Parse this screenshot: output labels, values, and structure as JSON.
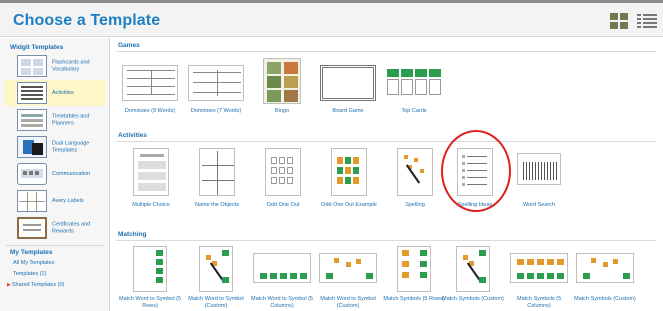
{
  "header": {
    "title": "Choose a Template"
  },
  "sidebar": {
    "widgit_heading": "Widgit Templates",
    "items": [
      {
        "label": "Flashcards and Vocabulary",
        "icon": "flashcards-icon",
        "active": false
      },
      {
        "label": "Activities",
        "icon": "activities-icon",
        "active": true
      },
      {
        "label": "Timetables and Planners",
        "icon": "timetables-icon",
        "active": false
      },
      {
        "label": "Dual Language Templates",
        "icon": "dual-language-icon",
        "active": false
      },
      {
        "label": "Communication",
        "icon": "communication-icon",
        "active": false
      },
      {
        "label": "Avery Labels",
        "icon": "avery-labels-icon",
        "active": false
      },
      {
        "label": "Certificates and Rewards",
        "icon": "certificates-icon",
        "active": false
      }
    ],
    "my_heading": "My Templates",
    "links": [
      "All My Templates",
      "Templates (1)",
      "Shared Templates (0)"
    ]
  },
  "sections": [
    {
      "title": "Games",
      "cards": [
        "Dominoes (9 Words)",
        "Dominoes (7 Words)",
        "Bingo",
        "Board Game",
        "Top Cards"
      ]
    },
    {
      "title": "Activities",
      "cards": [
        "Multiple Choice",
        "Name the Objects",
        "Odd One Out",
        "Odd One Out Example",
        "Spelling",
        "Spelling Ideas",
        "Word Search"
      ]
    },
    {
      "title": "Matching",
      "cards": [
        "Match Word to Symbol (5 Rows)",
        "Match Word to Symbol (Custom)",
        "Match Word to Symbol (5 Columns)",
        "Match Word to Symbol (Custom)",
        "Match Symbols (5 Rows)",
        "Match Symbols (Custom)",
        "Match Symbols (5 Columns)",
        "Match Symbols (Custom)"
      ]
    }
  ],
  "highlight": {
    "card": "Spelling Ideas",
    "color": "#e02020"
  },
  "colors": {
    "accent": "#1d7fc4",
    "active_bg": "#fdf6c8",
    "header_bg": "#f3f3f3"
  }
}
